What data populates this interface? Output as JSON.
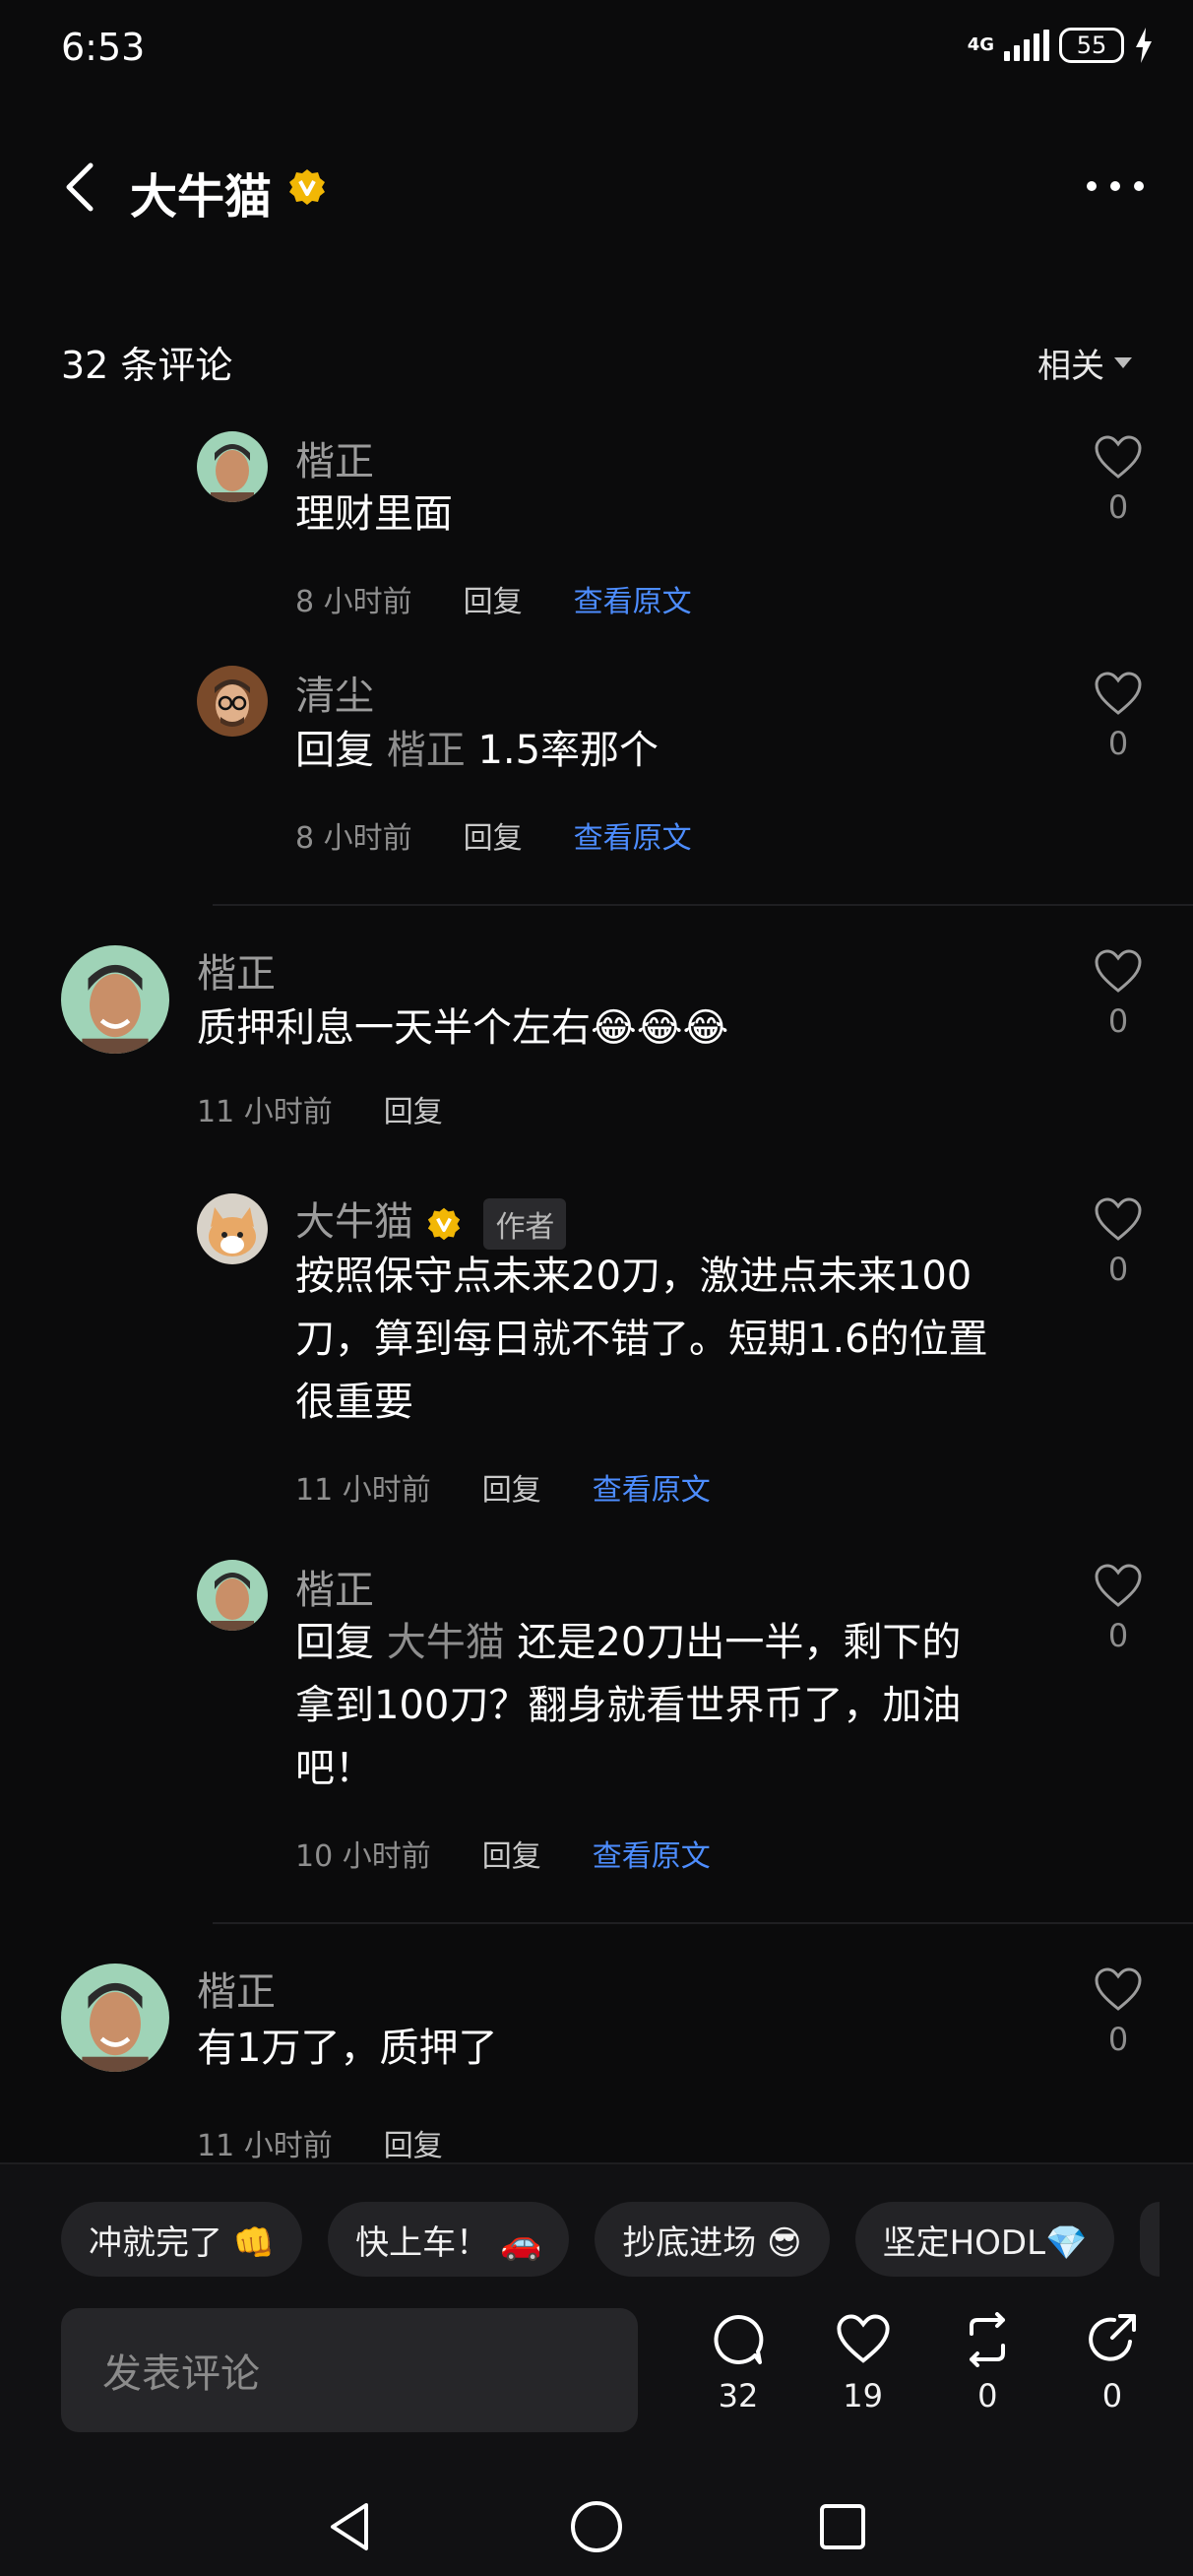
{
  "status": {
    "time": "6:53",
    "network": "4G",
    "battery": "55"
  },
  "header": {
    "title": "大牛猫"
  },
  "comments_header": {
    "count": "32 条评论",
    "sort": "相关"
  },
  "comments": [
    {
      "name": "楷正",
      "text": "理财里面",
      "time": "8 小时前",
      "reply": "回复",
      "original": "查看原文",
      "likes": "0"
    },
    {
      "name": "清尘",
      "prefix": "回复",
      "mention": "楷正",
      "text": "1.5率那个",
      "time": "8 小时前",
      "reply": "回复",
      "original": "查看原文",
      "likes": "0"
    },
    {
      "name": "楷正",
      "text": "质押利息一天半个左右😂😂😂",
      "time": "11 小时前",
      "reply": "回复",
      "likes": "0"
    },
    {
      "name": "大牛猫",
      "tag": "作者",
      "text_lines": [
        "按照保守点未来20刀，激进点未来100",
        "刀，算到每日就不错了。短期1.6的位置",
        "很重要"
      ],
      "time": "11 小时前",
      "reply": "回复",
      "original": "查看原文",
      "likes": "0"
    },
    {
      "name": "楷正",
      "prefix": "回复",
      "mention": "大牛猫",
      "text_first": "还是20刀出一半，剩下的",
      "text_lines": [
        "拿到100刀？翻身就看世界币了，加油",
        "吧！"
      ],
      "time": "10 小时前",
      "reply": "回复",
      "original": "查看原文",
      "likes": "0"
    },
    {
      "name": "楷正",
      "text": "有1万了，质押了",
      "time": "11 小时前",
      "reply": "回复",
      "likes": "0"
    }
  ],
  "quick_replies": [
    "冲就完了 👊",
    "快上车！ 🚗",
    "抄底进场 😎",
    "坚定HODL💎"
  ],
  "input": {
    "placeholder": "发表评论"
  },
  "actions": {
    "comments": "32",
    "likes": "19",
    "reposts": "0",
    "shares": "0"
  },
  "icons": [
    "back-icon",
    "verified-badge-icon",
    "more-icon",
    "heart-icon",
    "comment-icon",
    "repost-icon",
    "share-icon",
    "nav-back-icon",
    "nav-home-icon",
    "nav-recents-icon"
  ],
  "colors": {
    "background": "#0b0b0c",
    "link": "#4d8dff",
    "badge": "#f2b705"
  }
}
